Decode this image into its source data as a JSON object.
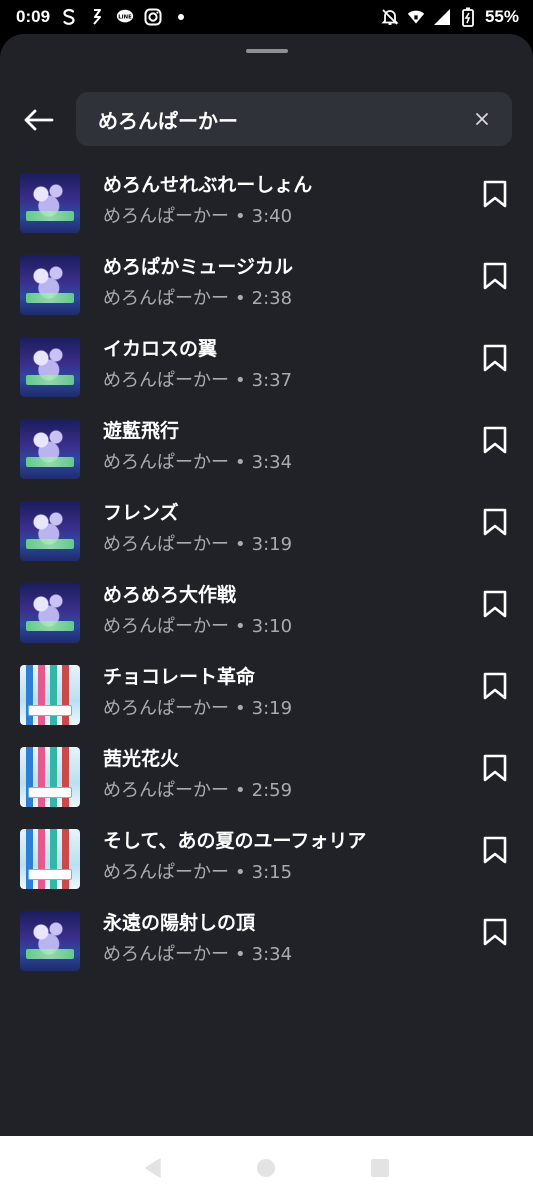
{
  "status_bar": {
    "time": "0:09",
    "battery": "55%",
    "icons": [
      "s-app-icon",
      "link-app-icon",
      "line-icon",
      "instagram-icon",
      "dot-icon",
      "muted-bell-icon",
      "wifi-icon",
      "signal-icon",
      "battery-icon"
    ]
  },
  "search": {
    "query": "めろんぱーかー",
    "back_icon": "back-arrow-icon",
    "clear_icon": "close-icon"
  },
  "colors": {
    "sheet_background": "#202227",
    "search_background": "#2f3238",
    "title_text": "#ffffff",
    "meta_text": "#a9abb0",
    "nav_background": "#ffffff"
  },
  "tracks": [
    {
      "title": "めろんせれぶれーしょん",
      "artist": "めろんぱーかー",
      "separator": "•",
      "duration": "3:40",
      "cover": "dark"
    },
    {
      "title": "めろぱかミュージカル",
      "artist": "めろんぱーかー",
      "separator": "•",
      "duration": "2:38",
      "cover": "dark"
    },
    {
      "title": "イカロスの翼",
      "artist": "めろんぱーかー",
      "separator": "•",
      "duration": "3:37",
      "cover": "dark"
    },
    {
      "title": "遊藍飛行",
      "artist": "めろんぱーかー",
      "separator": "•",
      "duration": "3:34",
      "cover": "dark"
    },
    {
      "title": "フレンズ",
      "artist": "めろんぱーかー",
      "separator": "•",
      "duration": "3:19",
      "cover": "dark"
    },
    {
      "title": "めろめろ大作戦",
      "artist": "めろんぱーかー",
      "separator": "•",
      "duration": "3:10",
      "cover": "dark"
    },
    {
      "title": "チョコレート革命",
      "artist": "めろんぱーかー",
      "separator": "•",
      "duration": "3:19",
      "cover": "light"
    },
    {
      "title": "茜光花火",
      "artist": "めろんぱーかー",
      "separator": "•",
      "duration": "2:59",
      "cover": "light"
    },
    {
      "title": "そして、あの夏のユーフォリア",
      "artist": "めろんぱーかー",
      "separator": "•",
      "duration": "3:15",
      "cover": "light"
    },
    {
      "title": "永遠の陽射しの頂",
      "artist": "めろんぱーかー",
      "separator": "•",
      "duration": "3:34",
      "cover": "dark"
    }
  ],
  "nav": {
    "buttons": [
      "back-triangle-icon",
      "home-circle-icon",
      "recents-square-icon"
    ]
  }
}
